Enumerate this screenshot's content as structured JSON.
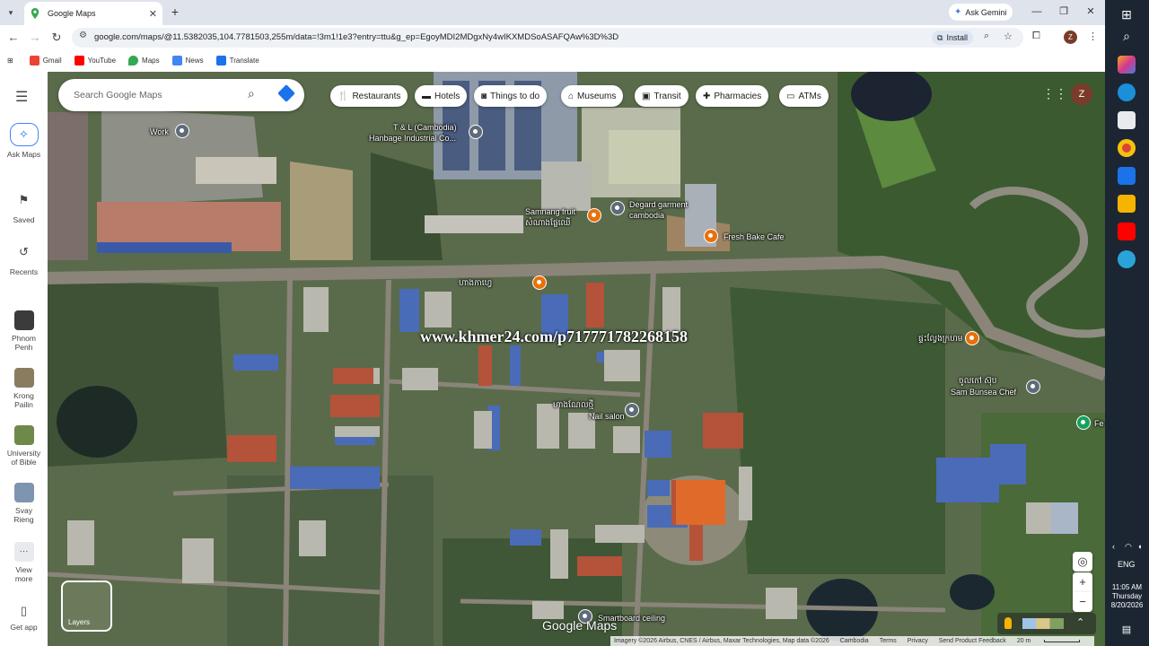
{
  "browser": {
    "tab": {
      "title": "Google Maps"
    },
    "ask_gemini": "Ask Gemini",
    "url": "google.com/maps/@11.5382035,104.7781503,255m/data=!3m1!1e3?entry=ttu&g_ep=EgoyMDI2MDgxNy4wIKXMDSoASAFQAw%3D%3D",
    "install_label": "Install",
    "profile_initial": "Z",
    "bookmarks": [
      "Gmail",
      "YouTube",
      "Maps",
      "News",
      "Translate"
    ]
  },
  "maps": {
    "search_placeholder": "Search Google Maps",
    "chips": [
      "Restaurants",
      "Hotels",
      "Things to do",
      "Museums",
      "Transit",
      "Pharmacies",
      "ATMs"
    ],
    "user_initial": "Z",
    "rail": {
      "ask": "Ask Maps",
      "saved": "Saved",
      "recents": "Recents",
      "places": [
        {
          "line1": "Phnom",
          "line2": "Penh"
        },
        {
          "line1": "Krong",
          "line2": "Pailin"
        },
        {
          "line1": "University",
          "line2": "of Bible"
        },
        {
          "line1": "Svay",
          "line2": "Rieng"
        }
      ],
      "view_more": "View more",
      "get_app": "Get app"
    },
    "pois": {
      "work": "Work",
      "tl_line1": "T & L (Cambodia)",
      "tl_line2": "Hanbage Industrial Co...",
      "samnang_line1": "Samnang fruit",
      "samnang_line2": "សំណាងផ្លែឈើ",
      "degard_line1": "Degard garment",
      "degard_line2": "cambodia",
      "fresh_bake": "Fresh Bake Cafe",
      "khmer_road_label": "ហាងកាហ្វេ",
      "right_label": "ផ្ទះល្វែងក្រហម",
      "sam_line1": "ចូលកៅ ស៊ុប",
      "sam_line2": "Sam Bunsea Chef",
      "nail_line1": "ហាងណែលថ្មី",
      "nail_line2": "Nail salon",
      "fe": "Fe",
      "smartboard": "Smartboard ceiling"
    },
    "watermark": "www.khmer24.com/p717771782268158",
    "layers_label": "Layers",
    "google_logo": "Google Maps",
    "footer": [
      "Imagery ©2026 Airbus, CNES / Airbus, Maxar Technologies, Map data ©2026",
      "Cambodia",
      "Terms",
      "Privacy",
      "Send Product Feedback",
      "20 m"
    ]
  },
  "taskbar": {
    "time": "11:05 AM",
    "day": "Thursday",
    "date": "8/20/2026",
    "lang": "ENG"
  }
}
